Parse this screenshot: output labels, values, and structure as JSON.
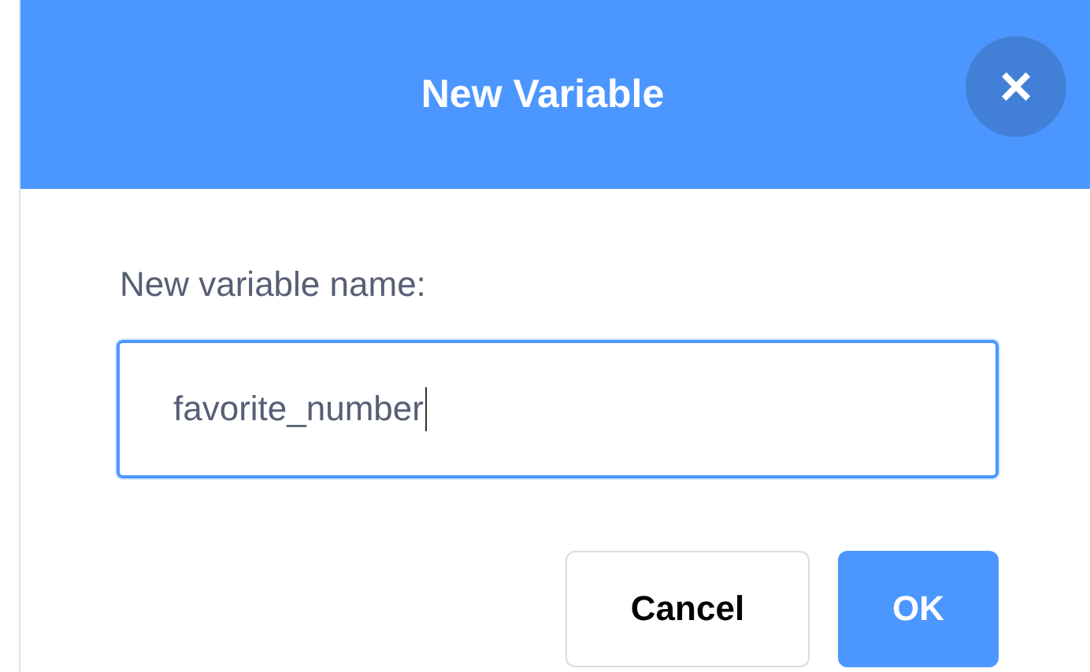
{
  "dialog": {
    "title": "New Variable",
    "close": "×"
  },
  "field": {
    "label": "New variable name:",
    "value": "favorite_number",
    "focused": true
  },
  "buttons": [
    {
      "label": "Cancel",
      "kind": "secondary"
    },
    {
      "label": "OK",
      "kind": "primary"
    }
  ]
}
